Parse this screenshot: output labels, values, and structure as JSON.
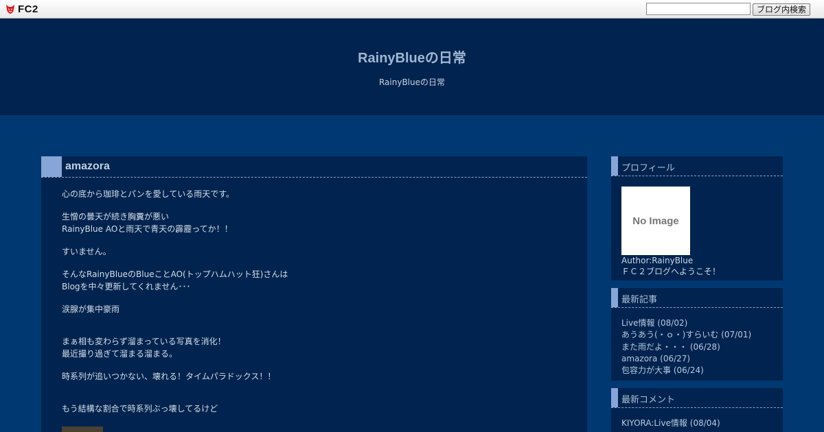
{
  "topbar": {
    "logo_text": "FC2",
    "search_placeholder": "",
    "search_button": "ブログ内検索"
  },
  "header": {
    "title": "RainyBlueの日常",
    "description": "RainyBlueの日常"
  },
  "entry": {
    "title": "amazora",
    "paragraphs": [
      {
        "lines": [
          "心の底から珈琲とパンを愛している雨天です。"
        ]
      },
      {
        "lines": [
          "生憎の曇天が続き胸糞が悪い",
          "RainyBlue AOと雨天で青天の霹靂ってか！！"
        ]
      },
      {
        "lines": [
          "すいません。"
        ]
      },
      {
        "lines": [
          "そんなRainyBlueのBlueことAO(トップハムハット狂)さんは",
          "Blogを中々更新してくれません･･･"
        ]
      },
      {
        "lines": [
          "涙腺が集中豪雨"
        ]
      },
      {
        "lines": [
          "まぁ相も変わらず溜まっている写真を消化！",
          "最近撮り過ぎて溜まる溜まる。"
        ]
      },
      {
        "lines": [
          "時系列が追いつかない、壊れる！タイムパラドックス！！"
        ]
      },
      {
        "lines": [
          "もう結構な割合で時系列ぶっ壊してるけど"
        ]
      }
    ]
  },
  "sidebar": {
    "profile": {
      "heading": "プロフィール",
      "image_text": "No Image",
      "author": "Author:RainyBlue",
      "welcome": "ＦＣ２ブログへようこそ！"
    },
    "recent_posts": {
      "heading": "最新記事",
      "items": [
        {
          "title": "Live情報",
          "date": "(08/02)"
        },
        {
          "title": "あうあう(・ｏ・)すらいむ",
          "date": "(07/01)"
        },
        {
          "title": "また雨だよ・・・",
          "date": "(06/28)"
        },
        {
          "title": "amazora",
          "date": "(06/27)"
        },
        {
          "title": "包容力が大事",
          "date": "(06/24)"
        }
      ]
    },
    "recent_comments": {
      "heading": "最新コメント",
      "items": [
        {
          "title": "KIYORA:Live情報",
          "date": "(08/04)"
        }
      ]
    }
  },
  "colors": {
    "page_bg": "#003871",
    "panel_bg": "#00244f",
    "accent": "#88a5d8",
    "title_text": "#a3b6d2"
  }
}
